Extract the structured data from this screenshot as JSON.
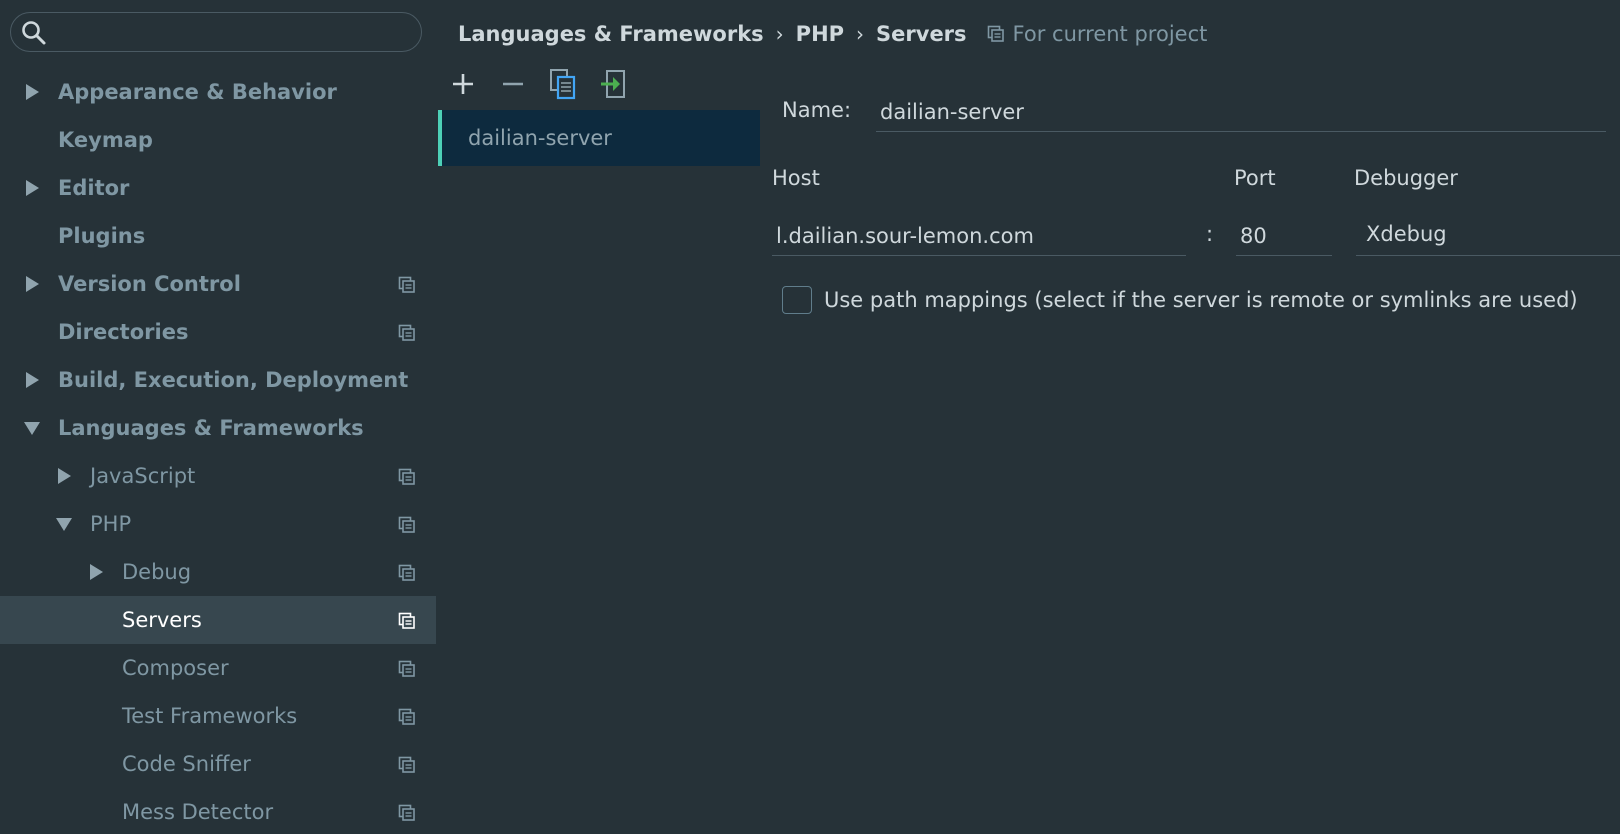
{
  "search": {
    "value": "",
    "placeholder": ""
  },
  "sidebar": {
    "items": [
      {
        "label": "Appearance & Behavior",
        "level": 0,
        "arrow": "right",
        "project_icon": false
      },
      {
        "label": "Keymap",
        "level": 0,
        "arrow": "none",
        "project_icon": false
      },
      {
        "label": "Editor",
        "level": 0,
        "arrow": "right",
        "project_icon": false
      },
      {
        "label": "Plugins",
        "level": 0,
        "arrow": "none",
        "project_icon": false
      },
      {
        "label": "Version Control",
        "level": 0,
        "arrow": "right",
        "project_icon": true
      },
      {
        "label": "Directories",
        "level": 0,
        "arrow": "none",
        "project_icon": true
      },
      {
        "label": "Build, Execution, Deployment",
        "level": 0,
        "arrow": "right",
        "project_icon": false
      },
      {
        "label": "Languages & Frameworks",
        "level": 0,
        "arrow": "down",
        "project_icon": false
      },
      {
        "label": "JavaScript",
        "level": 1,
        "arrow": "right",
        "project_icon": true
      },
      {
        "label": "PHP",
        "level": 1,
        "arrow": "down",
        "project_icon": true
      },
      {
        "label": "Debug",
        "level": 2,
        "arrow": "right",
        "project_icon": true
      },
      {
        "label": "Servers",
        "level": 2,
        "arrow": "none",
        "project_icon": true,
        "selected": true
      },
      {
        "label": "Composer",
        "level": 2,
        "arrow": "none",
        "project_icon": true
      },
      {
        "label": "Test Frameworks",
        "level": 2,
        "arrow": "none",
        "project_icon": true
      },
      {
        "label": "Code Sniffer",
        "level": 2,
        "arrow": "none",
        "project_icon": true
      },
      {
        "label": "Mess Detector",
        "level": 2,
        "arrow": "none",
        "project_icon": true
      }
    ]
  },
  "breadcrumb": {
    "parts": [
      "Languages & Frameworks",
      "PHP",
      "Servers"
    ],
    "separator": "›",
    "scope": "For current project"
  },
  "server_list": {
    "toolbar": [
      "add-icon",
      "remove-icon",
      "copy-icon",
      "import-icon"
    ],
    "items": [
      "dailian-server"
    ]
  },
  "form": {
    "name_label": "Name:",
    "name_value": "dailian-server",
    "host_label": "Host",
    "host_value": "l.dailian.sour-lemon.com",
    "port_separator": ":",
    "port_label": "Port",
    "port_value": "80",
    "debugger_label": "Debugger",
    "debugger_value": "Xdebug",
    "path_mappings_label": "Use path mappings (select if the server is remote or symlinks are used)",
    "path_mappings_checked": false
  },
  "colors": {
    "background": "#263238",
    "selected_row": "#37474f",
    "list_selected": "#0d2a3e",
    "accent": "#4dd0b7",
    "import_green": "#4caf50",
    "copy_blue": "#42a5f5"
  }
}
